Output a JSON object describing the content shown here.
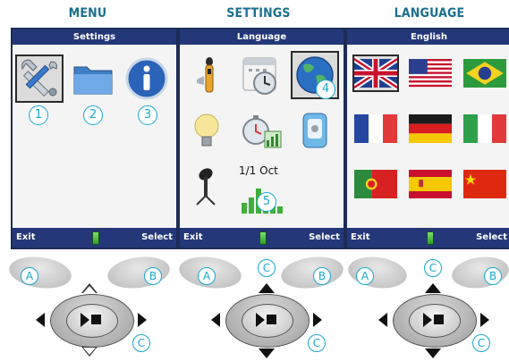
{
  "columns": [
    {
      "title": "MENU",
      "screen": {
        "header": "Settings",
        "footer_left": "Exit",
        "footer_right": "Select"
      },
      "markers": [
        "1",
        "2",
        "3"
      ],
      "control_marker": "C"
    },
    {
      "title": "SETTINGS",
      "screen": {
        "header": "Language",
        "footer_left": "Exit",
        "footer_right": "Select",
        "date_text": "1/1 Oct"
      },
      "markers": [
        "4",
        "5"
      ],
      "control_marker": "C"
    },
    {
      "title": "LANGUAGE",
      "screen": {
        "header": "English",
        "footer_left": "Exit",
        "footer_right": "Select"
      },
      "control_marker": "C"
    }
  ],
  "buttons": {
    "left": "A",
    "right": "B",
    "top": "C"
  },
  "icons": {
    "menu": [
      "tools-icon",
      "folder-icon",
      "info-icon"
    ],
    "settings": [
      "sound-level-meter-icon",
      "calendar-clock-icon",
      "globe-icon",
      "lightbulb-icon",
      "stopwatch-chart-icon",
      "device-icon",
      "microphone-icon",
      "bar-chart-icon"
    ],
    "flags": [
      "uk-flag",
      "usa-flag",
      "brazil-flag",
      "france-flag",
      "germany-flag",
      "italy-flag",
      "portugal-flag",
      "spain-flag",
      "china-flag"
    ]
  },
  "colors": {
    "header_bar": "#243779",
    "marker": "#19a7cf",
    "title": "#1a6f8e"
  }
}
